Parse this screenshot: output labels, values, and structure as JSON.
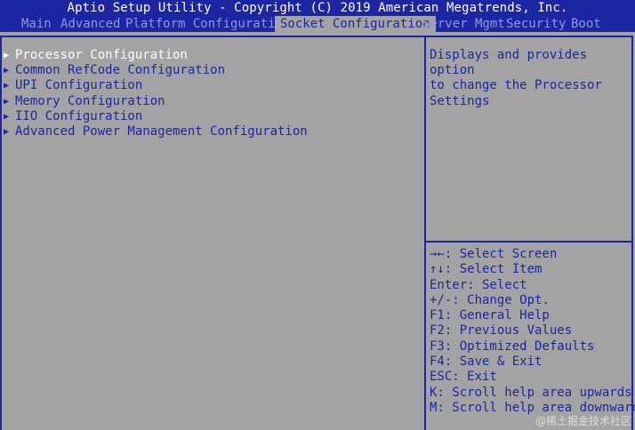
{
  "title": "Aptio Setup Utility - Copyright (C) 2019 American Megatrends, Inc.",
  "tabs": [
    {
      "label": "Main"
    },
    {
      "label": "Advanced"
    },
    {
      "label": "Platform Configuration"
    },
    {
      "label": "Socket Configuration",
      "active": true
    },
    {
      "label": "Server Mgmt"
    },
    {
      "label": "Security"
    },
    {
      "label": "Boot"
    }
  ],
  "menu": [
    {
      "label": "Processor Configuration",
      "selected": true
    },
    {
      "label": "Common RefCode Configuration"
    },
    {
      "label": "UPI Configuration"
    },
    {
      "label": "Memory Configuration"
    },
    {
      "label": "IIO Configuration"
    },
    {
      "label": "Advanced Power Management Configuration"
    }
  ],
  "arrow_glyph": "▶",
  "help_text": "Displays and provides option\nto change the Processor\nSettings",
  "keys": [
    "→←: Select Screen",
    "↑↓: Select Item",
    "Enter: Select",
    "+/-: Change Opt.",
    "F1: General Help",
    "F2: Previous Values",
    "F3: Optimized Defaults",
    "F4: Save & Exit",
    "ESC: Exit",
    "K: Scroll help area upwards",
    "M: Scroll help area downwards"
  ],
  "watermark": "@稀土掘金技术社区",
  "colors": {
    "background": "#a3a3a3",
    "bios_blue": "#1d26a2",
    "inactive_tab": "#8f98d8",
    "selected_text": "#ffffff"
  }
}
